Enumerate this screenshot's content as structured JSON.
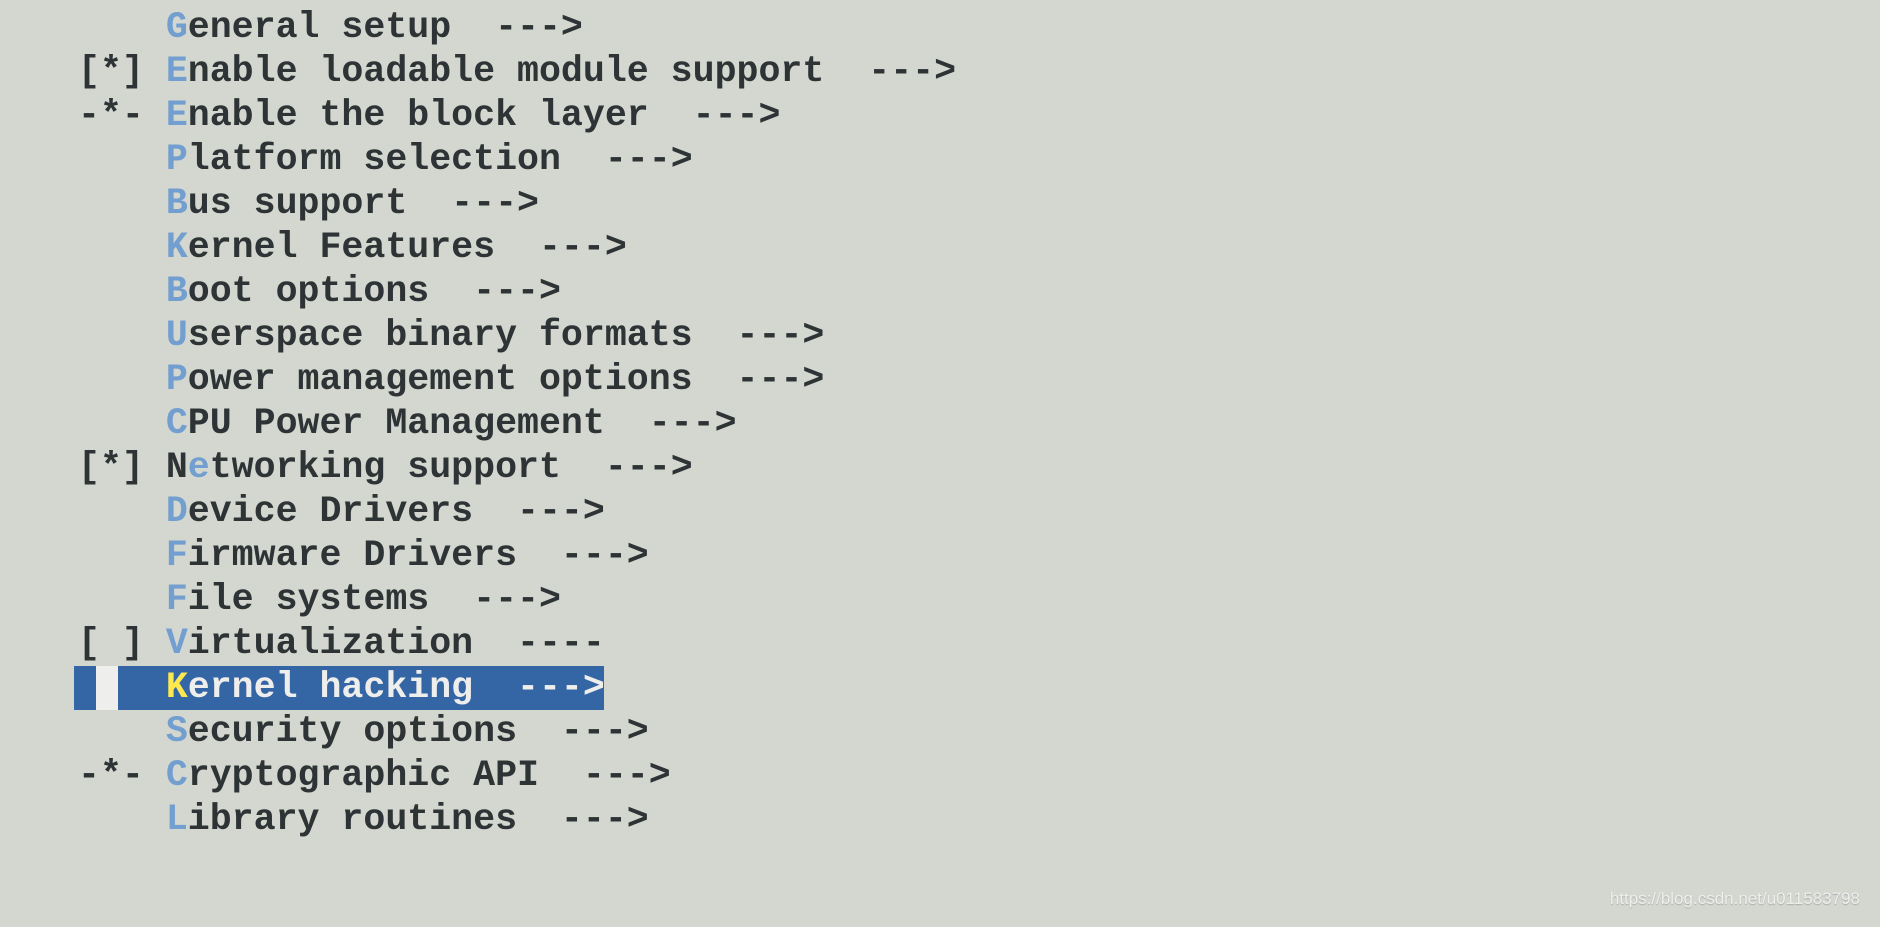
{
  "menu": {
    "items": [
      {
        "prefix": "    ",
        "pre": "",
        "hotkey": "G",
        "rest": "eneral setup",
        "suffix": "  --->"
      },
      {
        "prefix": "[*] ",
        "pre": "",
        "hotkey": "E",
        "rest": "nable loadable module support",
        "suffix": "  --->"
      },
      {
        "prefix": "-*- ",
        "pre": "",
        "hotkey": "E",
        "rest": "nable the block layer",
        "suffix": "  --->"
      },
      {
        "prefix": "    ",
        "pre": "",
        "hotkey": "P",
        "rest": "latform selection",
        "suffix": "  --->"
      },
      {
        "prefix": "    ",
        "pre": "",
        "hotkey": "B",
        "rest": "us support",
        "suffix": "  --->"
      },
      {
        "prefix": "    ",
        "pre": "",
        "hotkey": "K",
        "rest": "ernel Features",
        "suffix": "  --->"
      },
      {
        "prefix": "    ",
        "pre": "",
        "hotkey": "B",
        "rest": "oot options",
        "suffix": "  --->"
      },
      {
        "prefix": "    ",
        "pre": "",
        "hotkey": "U",
        "rest": "serspace binary formats",
        "suffix": "  --->"
      },
      {
        "prefix": "    ",
        "pre": "",
        "hotkey": "P",
        "rest": "ower management options",
        "suffix": "  --->"
      },
      {
        "prefix": "    ",
        "pre": "",
        "hotkey": "C",
        "rest": "PU Power Management",
        "suffix": "  --->"
      },
      {
        "prefix": "[*] ",
        "pre": "N",
        "hotkey": "e",
        "rest": "tworking support",
        "suffix": "  --->"
      },
      {
        "prefix": "    ",
        "pre": "",
        "hotkey": "D",
        "rest": "evice Drivers",
        "suffix": "  --->"
      },
      {
        "prefix": "    ",
        "pre": "",
        "hotkey": "F",
        "rest": "irmware Drivers",
        "suffix": "  --->"
      },
      {
        "prefix": "    ",
        "pre": "",
        "hotkey": "F",
        "rest": "ile systems",
        "suffix": "  --->"
      },
      {
        "prefix": "[ ] ",
        "pre": "",
        "hotkey": "V",
        "rest": "irtualization",
        "suffix": "  ----"
      },
      {
        "prefix": "    ",
        "pre": "",
        "hotkey": "K",
        "rest": "ernel hacking",
        "suffix": "  --->",
        "selected": true
      },
      {
        "prefix": "    ",
        "pre": "",
        "hotkey": "S",
        "rest": "ecurity options",
        "suffix": "  --->"
      },
      {
        "prefix": "-*- ",
        "pre": "",
        "hotkey": "C",
        "rest": "ryptographic API",
        "suffix": "  --->"
      },
      {
        "prefix": "    ",
        "pre": "",
        "hotkey": "L",
        "rest": "ibrary routines",
        "suffix": "  --->"
      }
    ]
  },
  "colors": {
    "background": "#d3d7cf",
    "text": "#2e3436",
    "hotkey": "#729fcf",
    "selection": "#3465a4",
    "selected_hotkey": "#fce94f"
  },
  "watermark": "https://blog.csdn.net/u011583798"
}
